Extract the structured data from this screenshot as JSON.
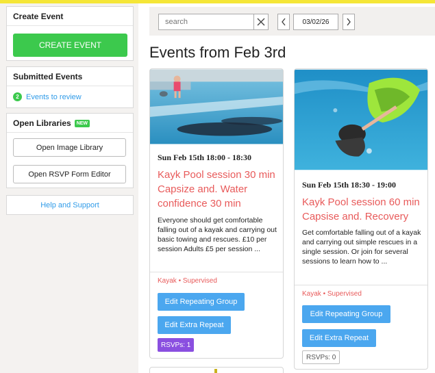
{
  "sidebar": {
    "create_event": {
      "heading": "Create Event",
      "button_label": "CREATE EVENT"
    },
    "submitted_events": {
      "heading": "Submitted Events",
      "review_count": "2",
      "review_label": "Events to review"
    },
    "open_libraries": {
      "heading": "Open Libraries",
      "new_badge": "NEW",
      "image_library_label": "Open Image Library",
      "rsvp_editor_label": "Open RSVP Form Editor"
    },
    "help_label": "Help and Support"
  },
  "toolbar": {
    "search_placeholder": "search",
    "date_value": "03/02/26"
  },
  "main": {
    "heading": "Events from Feb 3rd",
    "cards": [
      {
        "date": "Sun Feb 15th 18:00 - 18:30",
        "title": "Kayk Pool session 30 min Capsize and. Water confidence 30 min",
        "description": "Everyone should get comfortable falling out of a kayak and carrying out basic towing and rescues. £10 per session Adults £5 per session ...",
        "tags": "Kayak • Supervised",
        "edit_group_label": "Edit Repeating Group",
        "edit_extra_label": "Edit Extra Repeat",
        "rsvps": "RSVPs: 1"
      },
      {
        "date": "Sun Feb 15th 18:30 - 19:00",
        "title": "Kayk Pool session 60 min Capsise and. Recovery",
        "description": "Get comfortable falling out of a kayak and carrying out simple rescues in a single session. Or join for several sessions to learn how to ...",
        "tags": "Kayak • Supervised",
        "edit_group_label": "Edit Repeating Group",
        "edit_extra_label": "Edit Extra Repeat",
        "rsvps": "RSVPs: 0"
      }
    ]
  },
  "colors": {
    "accent_green": "#3cc94d",
    "link_blue": "#2f9be8",
    "button_blue": "#4ba7ef",
    "title_red": "#e85a5a",
    "rsvp_purple": "#8a4fe0",
    "top_banner": "#f5e637"
  },
  "icons": {
    "clear": "close-icon",
    "prev": "chevron-left-icon",
    "next": "chevron-right-icon"
  }
}
